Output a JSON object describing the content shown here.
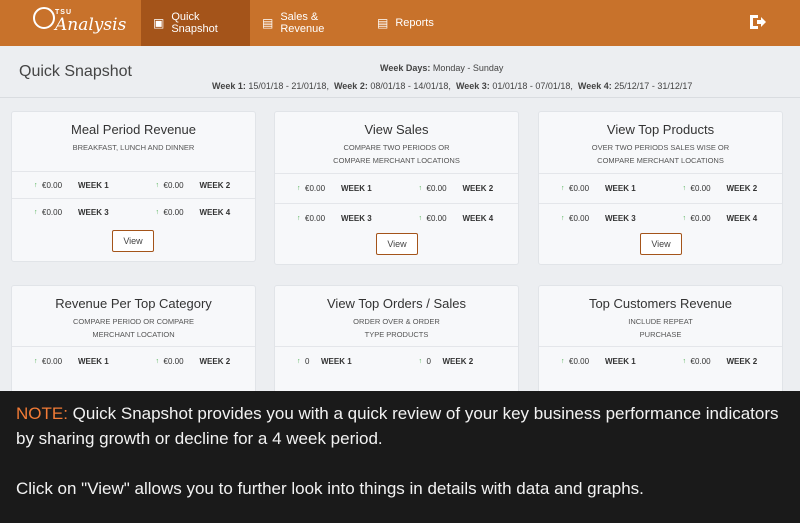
{
  "brand": {
    "small": "TSU",
    "name": "Analysis"
  },
  "nav": [
    {
      "label": "Quick Snapshot",
      "icon": "camera-icon",
      "active": true
    },
    {
      "label": "Sales & Revenue",
      "icon": "cash-icon",
      "active": false
    },
    {
      "label": "Reports",
      "icon": "document-icon",
      "active": false
    }
  ],
  "header": {
    "title": "Quick Snapshot",
    "week_days_label": "Week Days:",
    "week_days_value": "Monday - Sunday",
    "weeks": [
      {
        "label": "Week 1:",
        "range": "15/01/18 - 21/01/18,"
      },
      {
        "label": "Week 2:",
        "range": "08/01/18 - 14/01/18,"
      },
      {
        "label": "Week 3:",
        "range": "01/01/18 - 07/01/18,"
      },
      {
        "label": "Week 4:",
        "range": "25/12/17 - 31/12/17"
      }
    ]
  },
  "cards": [
    {
      "title": "Meal Period Revenue",
      "sub1": "BREAKFAST, LUNCH AND DINNER",
      "sub2": "",
      "metrics": [
        [
          "€0.00",
          "WEEK 1"
        ],
        [
          "€0.00",
          "WEEK 2"
        ],
        [
          "€0.00",
          "WEEK 3"
        ],
        [
          "€0.00",
          "WEEK 4"
        ]
      ],
      "view": "View"
    },
    {
      "title": "View Sales",
      "sub1": "COMPARE TWO PERIODS OR",
      "sub2": "COMPARE MERCHANT LOCATIONS",
      "metrics": [
        [
          "€0.00",
          "WEEK 1"
        ],
        [
          "€0.00",
          "WEEK 2"
        ],
        [
          "€0.00",
          "WEEK 3"
        ],
        [
          "€0.00",
          "WEEK 4"
        ]
      ],
      "view": "View"
    },
    {
      "title": "View Top Products",
      "sub1": "OVER TWO PERIODS SALES WISE OR",
      "sub2": "COMPARE MERCHANT LOCATIONS",
      "metrics": [
        [
          "€0.00",
          "WEEK 1"
        ],
        [
          "€0.00",
          "WEEK 2"
        ],
        [
          "€0.00",
          "WEEK 3"
        ],
        [
          "€0.00",
          "WEEK 4"
        ]
      ],
      "view": "View"
    },
    {
      "title": "Revenue Per Top Category",
      "sub1": "COMPARE PERIOD OR COMPARE",
      "sub2": "MERCHANT LOCATION",
      "metrics": [
        [
          "€0.00",
          "WEEK 1"
        ],
        [
          "€0.00",
          "WEEK 2"
        ]
      ]
    },
    {
      "title": "View Top Orders / Sales",
      "sub1": "ORDER OVER & ORDER",
      "sub2": "TYPE PRODUCTS",
      "metrics": [
        [
          "0",
          "WEEK 1"
        ],
        [
          "0",
          "WEEK 2"
        ]
      ]
    },
    {
      "title": "Top Customers Revenue",
      "sub1": "INCLUDE REPEAT",
      "sub2": "PURCHASE",
      "metrics": [
        [
          "€0.00",
          "WEEK 1"
        ],
        [
          "€0.00",
          "WEEK 2"
        ]
      ]
    }
  ],
  "note": {
    "label": "NOTE:",
    "text1": " Quick Snapshot provides you with a quick review of your key business performance indicators by sharing growth or decline for a 4 week period.",
    "text2": "Click on \"View\" allows you to further look into things in details with data and graphs."
  },
  "colors": {
    "brand": "#c8722b",
    "nav_active": "#a4541a",
    "growth": "#4caf50",
    "note_label": "#f27b36"
  }
}
